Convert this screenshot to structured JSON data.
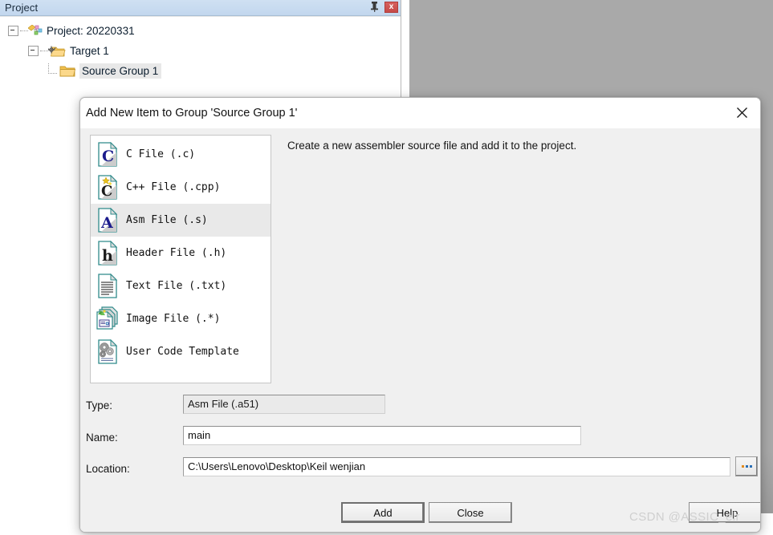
{
  "project_panel": {
    "title": "Project",
    "pin_icon": "pin-icon",
    "close_icon": "close-icon",
    "close_label": "x",
    "tree": [
      {
        "label": "Project: 20220331",
        "icon": "project-icon",
        "level": 0,
        "expanded": true,
        "selected": false
      },
      {
        "label": "Target 1",
        "icon": "target-icon",
        "level": 1,
        "expanded": true,
        "selected": false
      },
      {
        "label": "Source Group 1",
        "icon": "folder-icon",
        "level": 2,
        "expanded": false,
        "selected": true
      }
    ]
  },
  "dialog": {
    "title": "Add New Item to Group 'Source Group 1'",
    "close_icon": "close-icon",
    "description": "Create a new assembler source file and add it to the project.",
    "file_types": [
      {
        "label": "C File (.c)",
        "icon": "c-file-icon",
        "selected": false
      },
      {
        "label": "C++ File (.cpp)",
        "icon": "cpp-file-icon",
        "selected": false
      },
      {
        "label": "Asm File (.s)",
        "icon": "asm-file-icon",
        "selected": true
      },
      {
        "label": "Header File (.h)",
        "icon": "header-file-icon",
        "selected": false
      },
      {
        "label": "Text File (.txt)",
        "icon": "text-file-icon",
        "selected": false
      },
      {
        "label": "Image File (.*)",
        "icon": "image-file-icon",
        "selected": false
      },
      {
        "label": "User Code Template",
        "icon": "user-code-template-icon",
        "selected": false
      }
    ],
    "fields": {
      "type_label": "Type:",
      "type_value": "Asm File (.a51)",
      "name_label": "Name:",
      "name_value": "main",
      "location_label": "Location:",
      "location_value": "C:\\Users\\Lenovo\\Desktop\\Keil  wenjian",
      "browse_label": "..."
    },
    "buttons": {
      "add": "Add",
      "close": "Close",
      "help": "Help"
    }
  },
  "watermark": "CSDN @ASSIC_elr"
}
